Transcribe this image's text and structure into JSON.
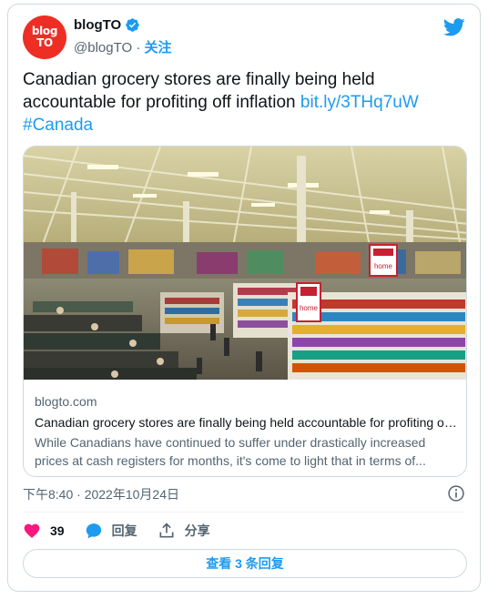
{
  "author": {
    "avatar_line1": "blog",
    "avatar_line2": "TO",
    "display_name": "blogTO",
    "handle": "@blogTO",
    "separator": "·",
    "follow_label": "关注"
  },
  "tweet": {
    "text": "Canadian grocery stores are finally being held accountable for profiting off inflation ",
    "link": "bit.ly/3THq7uW",
    "hashtag": "#Canada"
  },
  "link_card": {
    "domain": "blogto.com",
    "title": "Canadian grocery stores are finally being held accountable for profiting off inflation",
    "description_line1": "While Canadians have continued to suffer under drastically increased",
    "description_line2": "prices at cash registers for months, it's come to light that in terms of...",
    "image_signs": [
      "home",
      "home"
    ]
  },
  "meta": {
    "timestamp": "下午8:40 · 2022年10月24日"
  },
  "actions": {
    "like_count": "39",
    "reply_label": "回复",
    "share_label": "分享"
  },
  "view_replies_label": "查看 3 条回复",
  "colors": {
    "accent": "#1d9bf0",
    "like": "#f91880",
    "avatar_bg": "#ee2e24"
  }
}
